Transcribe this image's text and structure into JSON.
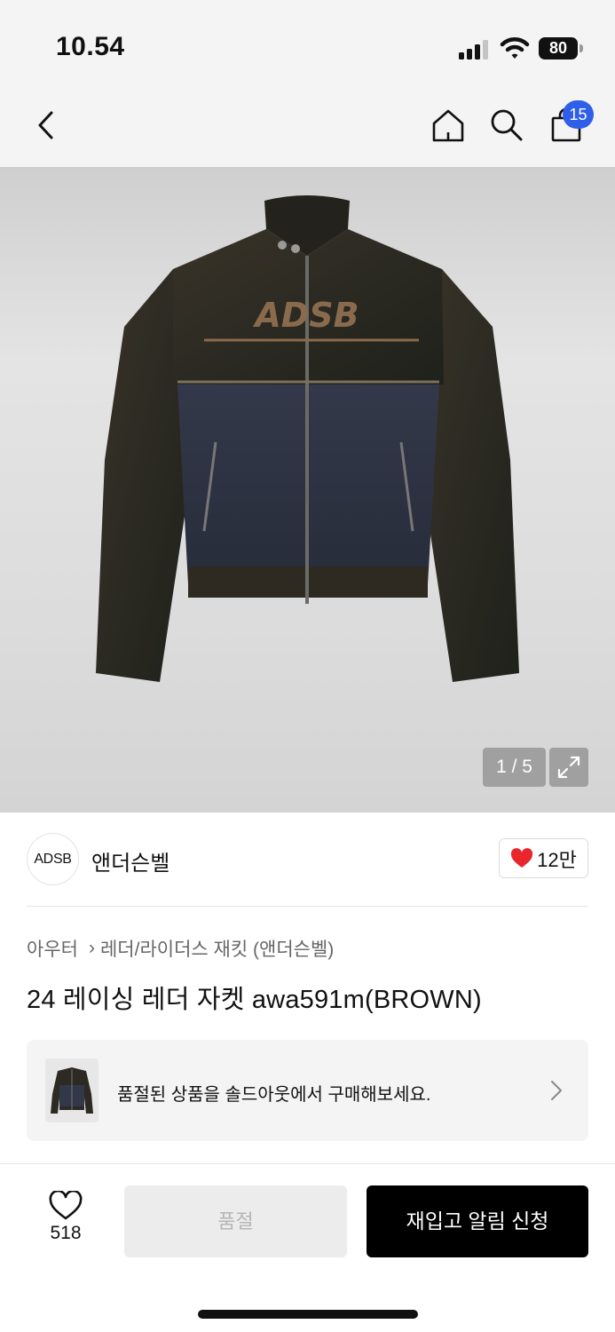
{
  "status_bar": {
    "time": "10.54",
    "battery": "80",
    "icons": [
      "signal-icon",
      "wifi-icon",
      "battery-icon"
    ]
  },
  "nav": {
    "cart_count": "15",
    "icons": [
      "back-icon",
      "home-icon",
      "search-icon",
      "shopping-bag-icon"
    ]
  },
  "gallery": {
    "counter": "1 / 5",
    "current": 1,
    "total": 5,
    "jacket_logo_text": "ADSB"
  },
  "brand": {
    "logo_text": "ADSB",
    "name": "앤더슨벨",
    "likes": "12만",
    "like_color": "#e8262c"
  },
  "breadcrumb": {
    "category": "아우터",
    "subcategory": "레더/라이더스 재킷 (앤더슨벨)"
  },
  "product": {
    "title": "24 레이싱 레더 자켓 awa591m(BROWN)"
  },
  "soldout_banner": {
    "text": "품절된 상품을 솔드아웃에서 구매해보세요."
  },
  "bottom_bar": {
    "wish_count": "518",
    "soldout_label": "품절",
    "restock_label": "재입고 알림 신청"
  },
  "colors": {
    "accent_badge": "#2f5fe8",
    "primary_button": "#000000",
    "disabled_button": "#ececec"
  }
}
